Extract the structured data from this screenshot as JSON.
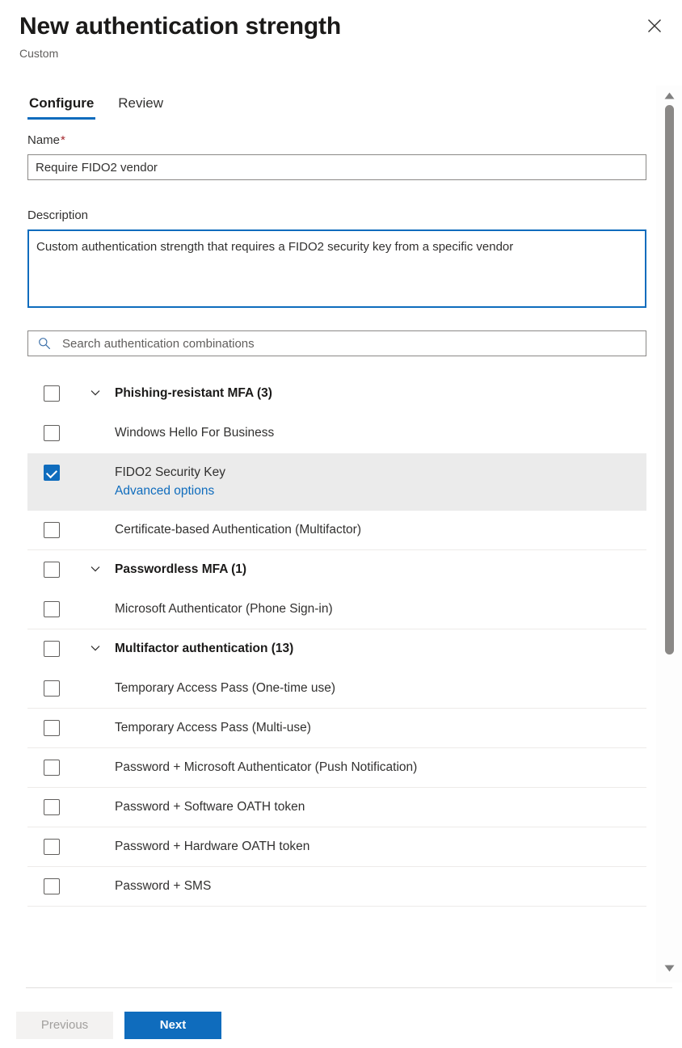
{
  "header": {
    "title": "New authentication strength",
    "subtitle": "Custom",
    "close_icon": "close-icon"
  },
  "tabs": [
    {
      "label": "Configure",
      "active": true
    },
    {
      "label": "Review",
      "active": false
    }
  ],
  "form": {
    "name": {
      "label": "Name",
      "required_marker": "*",
      "value": "Require FIDO2 vendor",
      "placeholder": ""
    },
    "description": {
      "label": "Description",
      "value": "Custom authentication strength that requires a FIDO2 security key from a specific vendor",
      "placeholder": "",
      "focused": true
    }
  },
  "search": {
    "placeholder": "Search authentication combinations",
    "value": "",
    "icon": "search-icon"
  },
  "combinations": [
    {
      "label": "Phishing-resistant MFA (3)",
      "type": "group",
      "checked": false,
      "expanded": true,
      "chevron": "chevron-down-icon",
      "separator_below": false,
      "highlighted": false
    },
    {
      "label": "Windows Hello For Business",
      "type": "item",
      "checked": false,
      "separator_below": false,
      "highlighted": false
    },
    {
      "label": "FIDO2 Security Key",
      "type": "item",
      "checked": true,
      "sub_link": "Advanced options",
      "separator_below": false,
      "highlighted": true
    },
    {
      "label": "Certificate-based Authentication (Multifactor)",
      "type": "item",
      "checked": false,
      "separator_below": true,
      "highlighted": false
    },
    {
      "label": "Passwordless MFA (1)",
      "type": "group",
      "checked": false,
      "expanded": true,
      "chevron": "chevron-down-icon",
      "separator_below": false,
      "highlighted": false
    },
    {
      "label": "Microsoft Authenticator (Phone Sign-in)",
      "type": "item",
      "checked": false,
      "separator_below": true,
      "highlighted": false
    },
    {
      "label": "Multifactor authentication (13)",
      "type": "group",
      "checked": false,
      "expanded": true,
      "chevron": "chevron-down-icon",
      "separator_below": false,
      "highlighted": false
    },
    {
      "label": "Temporary Access Pass (One-time use)",
      "type": "item",
      "checked": false,
      "separator_below": true,
      "highlighted": false
    },
    {
      "label": "Temporary Access Pass (Multi-use)",
      "type": "item",
      "checked": false,
      "separator_below": true,
      "highlighted": false
    },
    {
      "label": "Password + Microsoft Authenticator (Push Notification)",
      "type": "item",
      "checked": false,
      "separator_below": true,
      "highlighted": false
    },
    {
      "label": "Password + Software OATH token",
      "type": "item",
      "checked": false,
      "separator_below": true,
      "highlighted": false
    },
    {
      "label": "Password + Hardware OATH token",
      "type": "item",
      "checked": false,
      "separator_below": true,
      "highlighted": false
    },
    {
      "label": "Password + SMS",
      "type": "item",
      "checked": false,
      "separator_below": true,
      "highlighted": false
    }
  ],
  "scrollbar": {
    "up_icon": "scroll-up-arrow-icon",
    "down_icon": "scroll-down-arrow-icon"
  },
  "footer": {
    "previous_label": "Previous",
    "previous_disabled": true,
    "next_label": "Next"
  },
  "colors": {
    "accent": "#0f6cbd",
    "required": "#a4262c",
    "row_selected": "#ebebeb",
    "separator": "#edebe9",
    "border": "#8a8886",
    "text": "#323130",
    "muted": "#605e5c",
    "scroll_thumb": "#8a8886"
  }
}
